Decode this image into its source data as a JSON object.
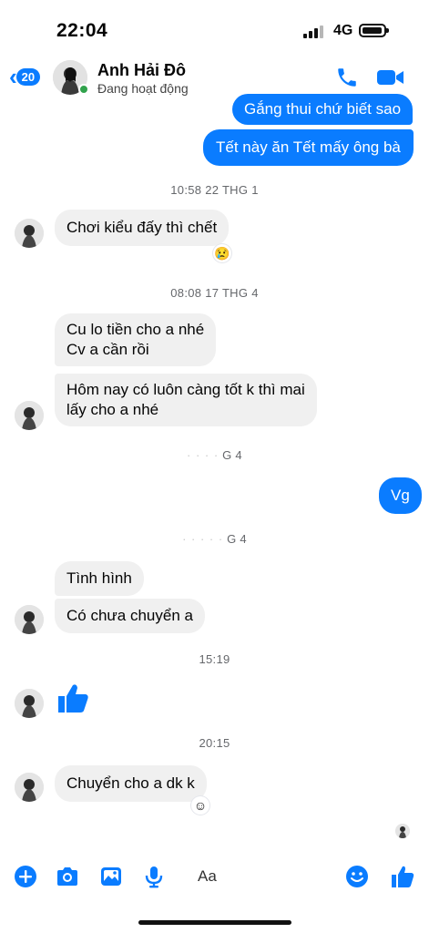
{
  "status": {
    "time": "22:04",
    "network": "4G"
  },
  "header": {
    "back_count": "20",
    "contact_name": "Anh Hải Đô",
    "contact_status": "Đang hoạt động"
  },
  "messages": {
    "out_1": "Gắng thui chứ biết sao",
    "out_2": "Tết này ăn Tết mấy ông bà",
    "ts_1": "10:58 22 THG 1",
    "in_1": "Chơi kiểu đấy thì chết",
    "ts_2": "08:08 17 THG 4",
    "in_2_line1": "Cu lo tiền cho a nhé",
    "in_2_line2": "Cv a cần rồi",
    "in_3_line1": "Hôm nay có luôn càng tốt k thì mai",
    "in_3_line2": "lấy cho a nhé",
    "ts_3": "G 4",
    "out_3": "Vg",
    "ts_4": "G 4",
    "in_4": "Tình hình",
    "in_5": "Có chưa chuyển a",
    "ts_5": "15:19",
    "ts_6": "20:15",
    "in_6": "Chuyển cho a dk k"
  },
  "reactions": {
    "sad": "😢",
    "emoji_add": "☺"
  },
  "composer": {
    "placeholder": "Aa"
  },
  "colors": {
    "accent": "#0a7cff",
    "incoming_bubble": "#f0f0f0",
    "online": "#31a24c"
  },
  "icons": [
    "plus-icon",
    "camera-icon",
    "image-icon",
    "microphone-icon",
    "emoji-icon",
    "like-icon",
    "phone-icon",
    "video-icon",
    "back-chevron-icon"
  ]
}
